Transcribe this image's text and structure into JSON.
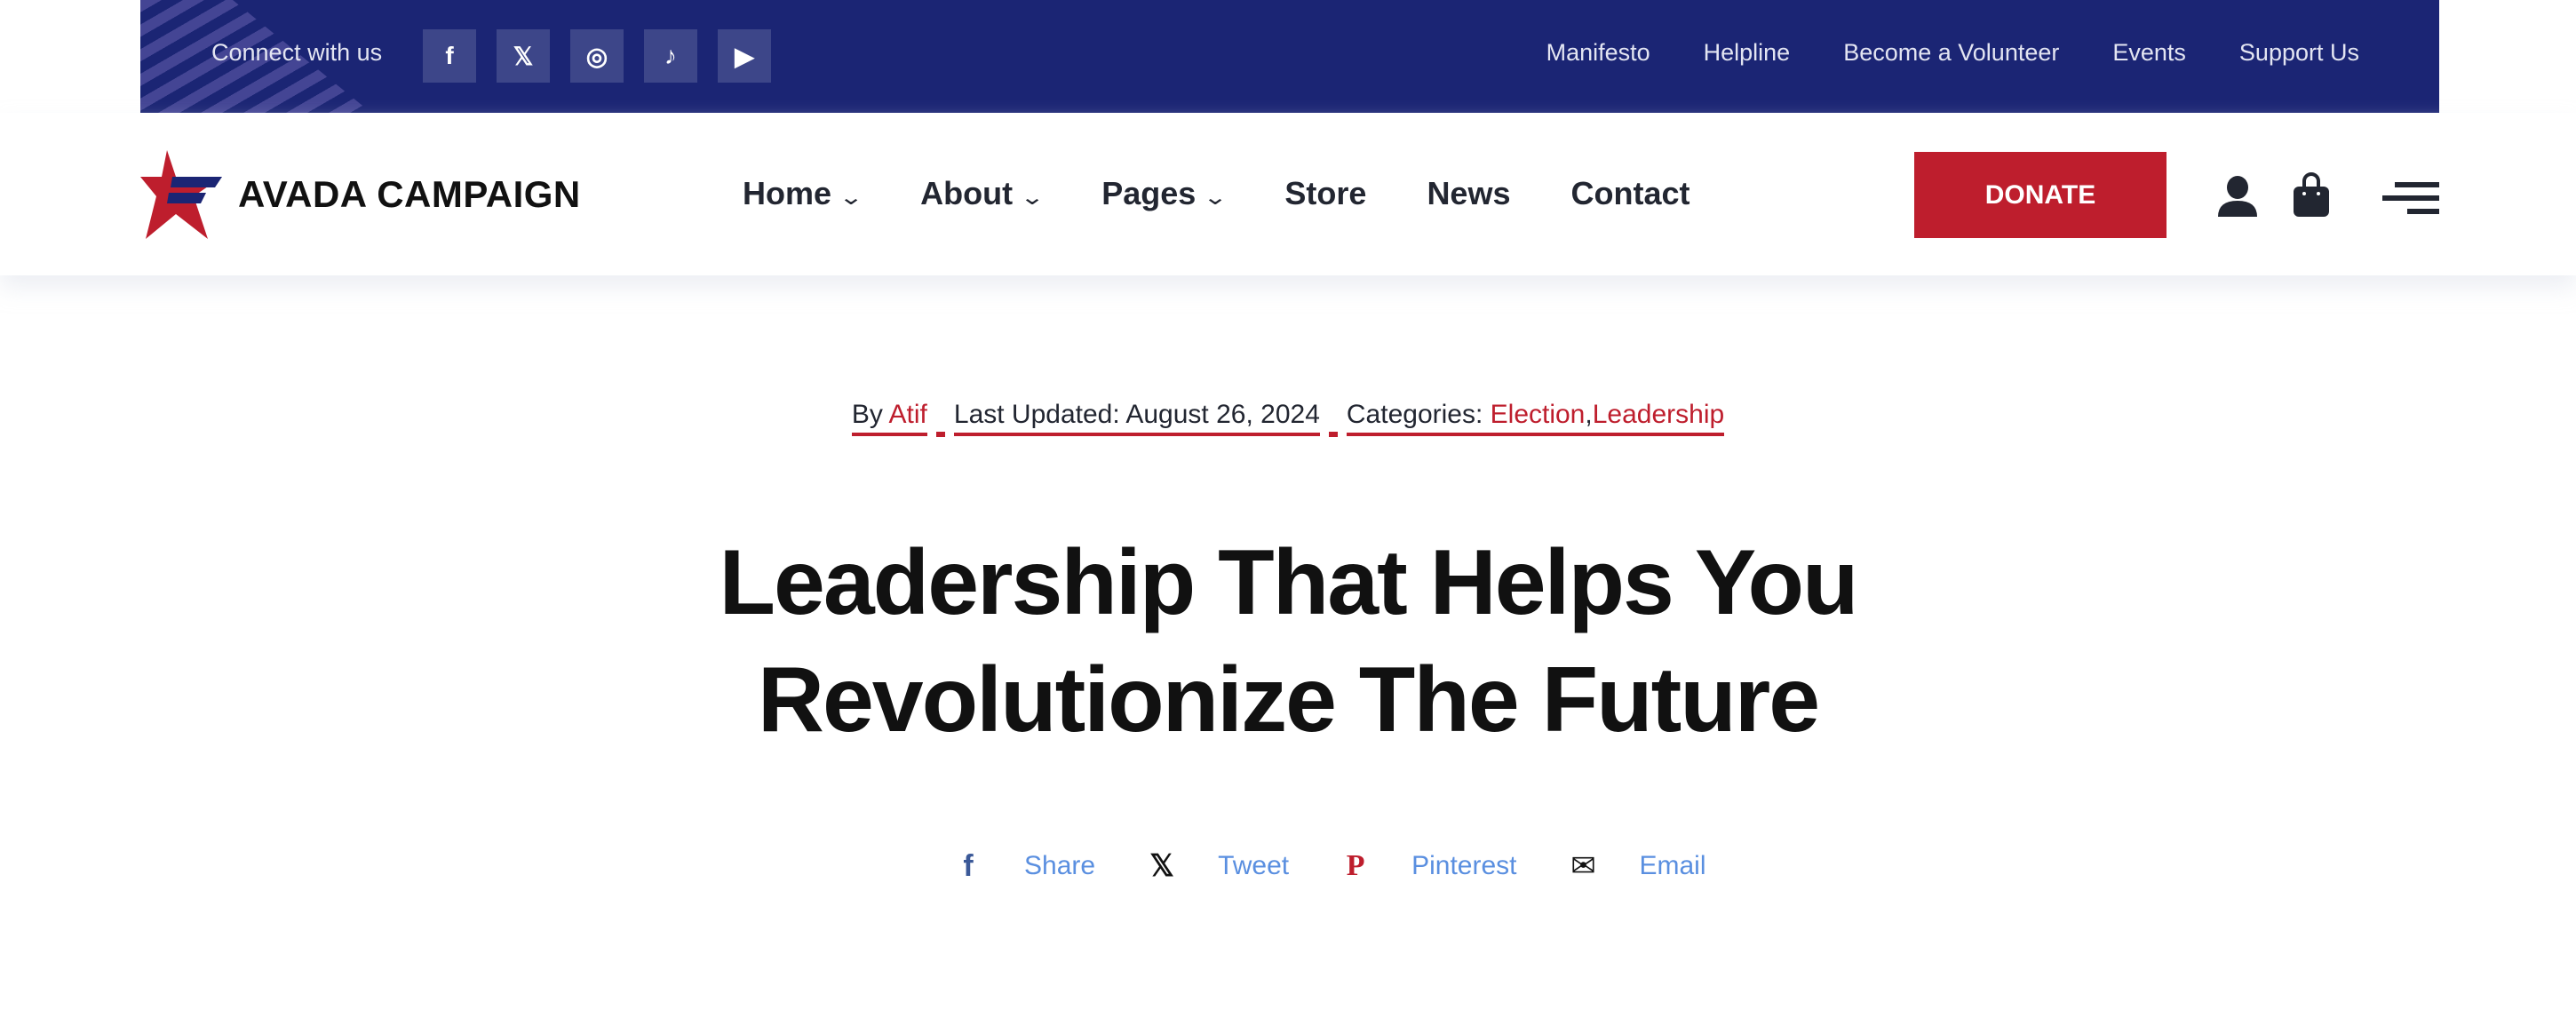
{
  "topbar": {
    "connect_label": "Connect with us",
    "socials": [
      {
        "icon": "facebook-icon",
        "glyph": "f"
      },
      {
        "icon": "x-icon",
        "glyph": "𝕏"
      },
      {
        "icon": "instagram-icon",
        "glyph": "◎"
      },
      {
        "icon": "tiktok-icon",
        "glyph": "♪"
      },
      {
        "icon": "youtube-icon",
        "glyph": "▶"
      }
    ],
    "links": [
      "Manifesto",
      "Helpline",
      "Become a Volunteer",
      "Events",
      "Support Us"
    ]
  },
  "header": {
    "logo_text": "AVADA CAMPAIGN",
    "nav": [
      {
        "label": "Home",
        "dropdown": true
      },
      {
        "label": "About",
        "dropdown": true
      },
      {
        "label": "Pages",
        "dropdown": true
      },
      {
        "label": "Store"
      },
      {
        "label": "News"
      },
      {
        "label": "Contact"
      }
    ],
    "chevron": "⌄",
    "donate_label": "DONATE"
  },
  "meta": {
    "by": "By ",
    "author": "Atif",
    "updated": "Last Updated: August 26, 2024",
    "categories_label": "Categories: ",
    "categories": [
      "Election",
      "Leadership"
    ],
    "sep": ","
  },
  "post": {
    "title_line1": "Leadership That Helps You",
    "title_line2": "Revolutionize The Future"
  },
  "share": [
    {
      "label": "Share",
      "icon": "facebook-icon",
      "glyph": "f",
      "color": "#3b5998"
    },
    {
      "label": "Tweet",
      "icon": "x-icon",
      "glyph": "𝕏",
      "color": "#111111"
    },
    {
      "label": "Pinterest",
      "icon": "pinterest-icon",
      "glyph": "P",
      "color": "#be1e2d"
    },
    {
      "label": "Email",
      "icon": "email-icon",
      "glyph": "✉",
      "color": "#111111"
    }
  ],
  "colors": {
    "topbar": "#1b2574",
    "accent": "#be1e2d",
    "link": "#5a8fe0"
  }
}
